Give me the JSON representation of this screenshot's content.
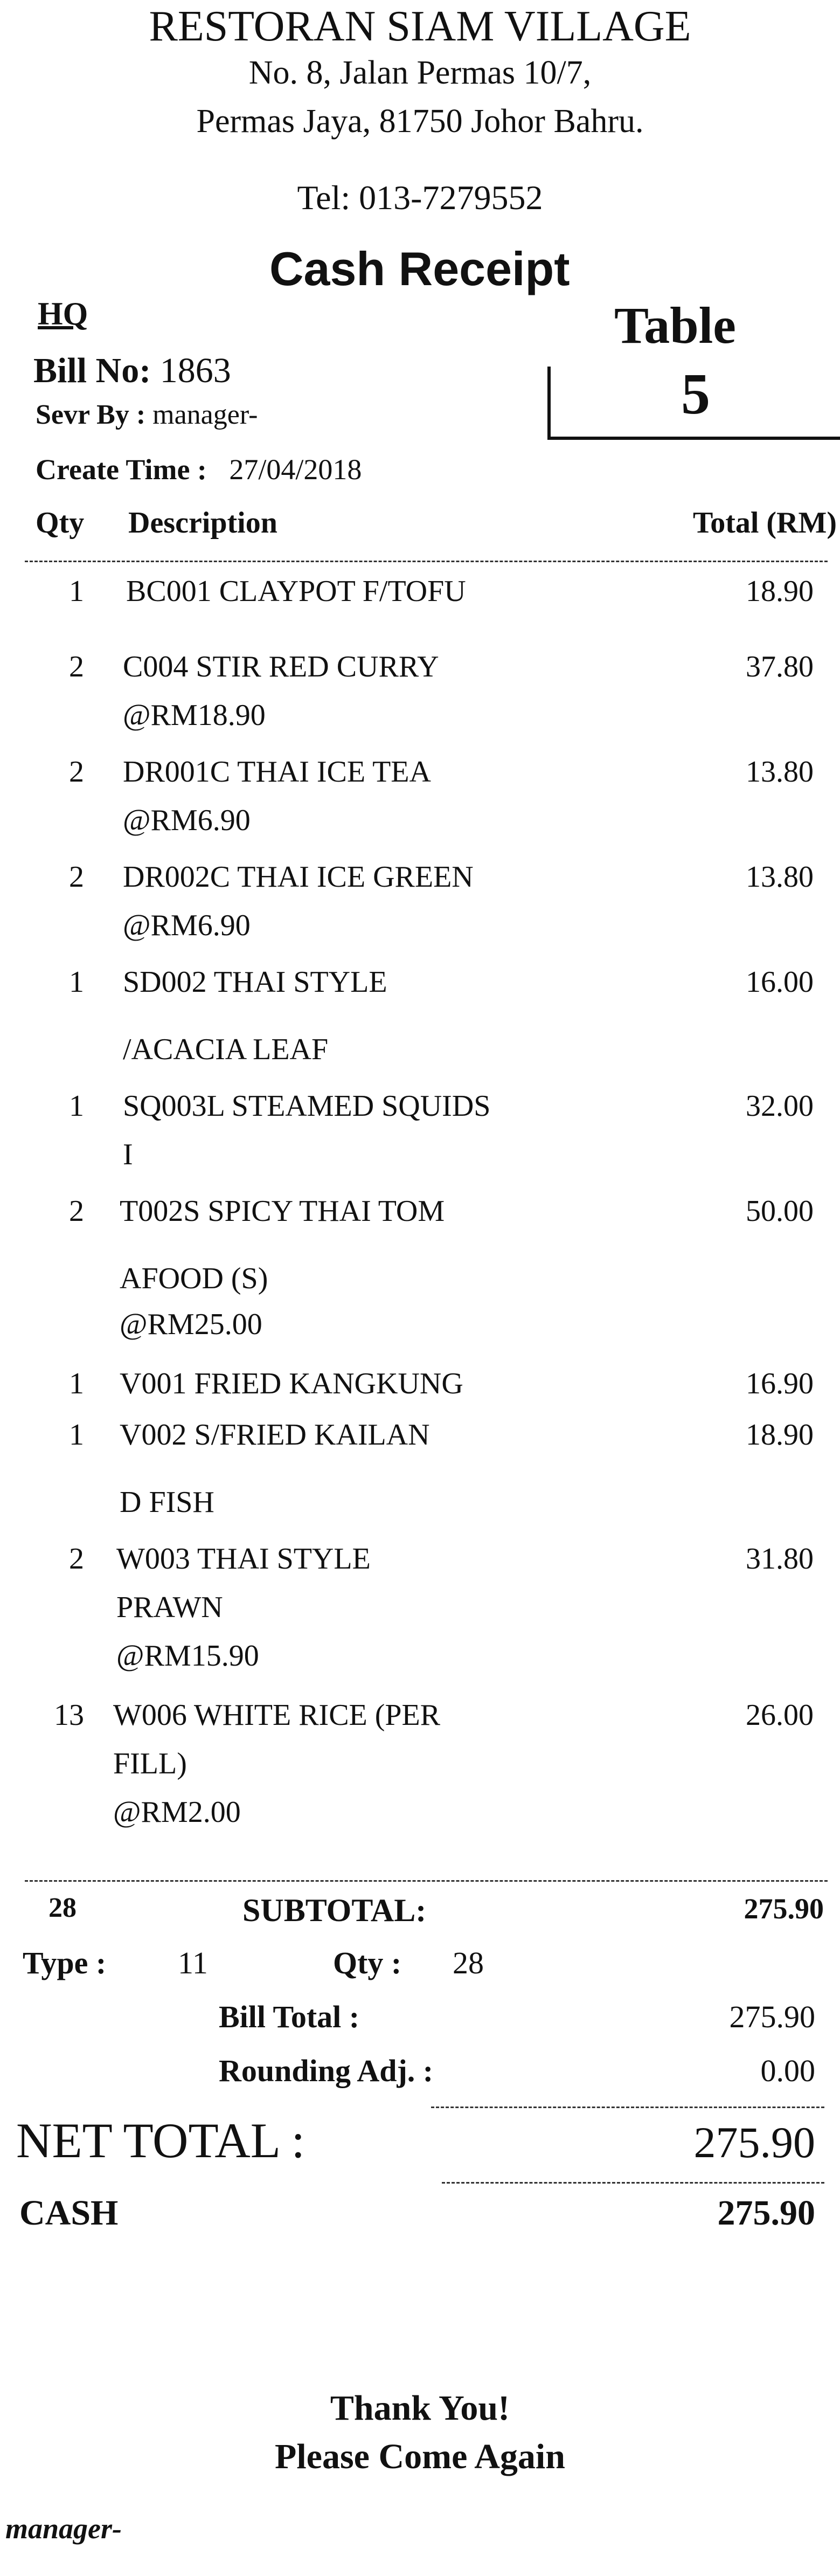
{
  "header": {
    "restaurant": "RESTORAN SIAM VILLAGE",
    "address1": "No. 8, Jalan Permas 10/7,",
    "address2": "Permas Jaya, 81750 Johor Bahru.",
    "tel": "Tel: 013-7279552",
    "title": "Cash Receipt"
  },
  "info": {
    "branch": "HQ",
    "bill_label": "Bill No:",
    "bill_no": "1863",
    "server_label": "Sevr By :",
    "server": "manager-",
    "time_label": "Create Time :",
    "time": "27/04/2018",
    "table_label": "Table",
    "table_no": "5"
  },
  "columns": {
    "qty": "Qty",
    "desc": "Description",
    "total": "Total (RM)"
  },
  "items": [
    {
      "qty": "1",
      "lines": [
        "BC001 CLAYPOT F/TOFU"
      ],
      "amount": "18.90"
    },
    {
      "qty": "2",
      "lines": [
        "C004 STIR RED CURRY",
        "@RM18.90"
      ],
      "amount": "37.80"
    },
    {
      "qty": "2",
      "lines": [
        "DR001C THAI ICE TEA",
        "@RM6.90"
      ],
      "amount": "13.80"
    },
    {
      "qty": "2",
      "lines": [
        "DR002C THAI ICE GREEN",
        "@RM6.90"
      ],
      "amount": "13.80"
    },
    {
      "qty": "1",
      "lines": [
        "SD002 THAI STYLE",
        "/ACACIA LEAF"
      ],
      "amount": "16.00"
    },
    {
      "qty": "1",
      "lines": [
        "SQ003L STEAMED SQUIDS",
        "I"
      ],
      "amount": "32.00"
    },
    {
      "qty": "2",
      "lines": [
        "T002S SPICY THAI TOM",
        "AFOOD (S)",
        "@RM25.00"
      ],
      "amount": "50.00"
    },
    {
      "qty": "1",
      "lines": [
        "V001 FRIED KANGKUNG"
      ],
      "amount": "16.90"
    },
    {
      "qty": "1",
      "lines": [
        "V002 S/FRIED KAILAN",
        "D FISH"
      ],
      "amount": "18.90"
    },
    {
      "qty": "2",
      "lines": [
        "W003 THAI STYLE",
        "PRAWN",
        "@RM15.90"
      ],
      "amount": "31.80"
    },
    {
      "qty": "13",
      "lines": [
        "W006 WHITE RICE (PER",
        "FILL)",
        "@RM2.00"
      ],
      "amount": "26.00"
    }
  ],
  "summary": {
    "total_qty": "28",
    "subtotal_label": "SUBTOTAL:",
    "subtotal": "275.90",
    "type_label": "Type :",
    "type_value": "11",
    "qty_label": "Qty :",
    "qty_value": "28",
    "bill_total_label": "Bill Total :",
    "bill_total": "275.90",
    "rounding_label": "Rounding Adj. :",
    "rounding": "0.00",
    "net_total_label": "NET TOTAL :",
    "net_total": "275.90",
    "cash_label": "CASH",
    "cash": "275.90"
  },
  "footer": {
    "thanks": "Thank You!",
    "come_again": "Please Come Again",
    "cashier": "manager-"
  }
}
